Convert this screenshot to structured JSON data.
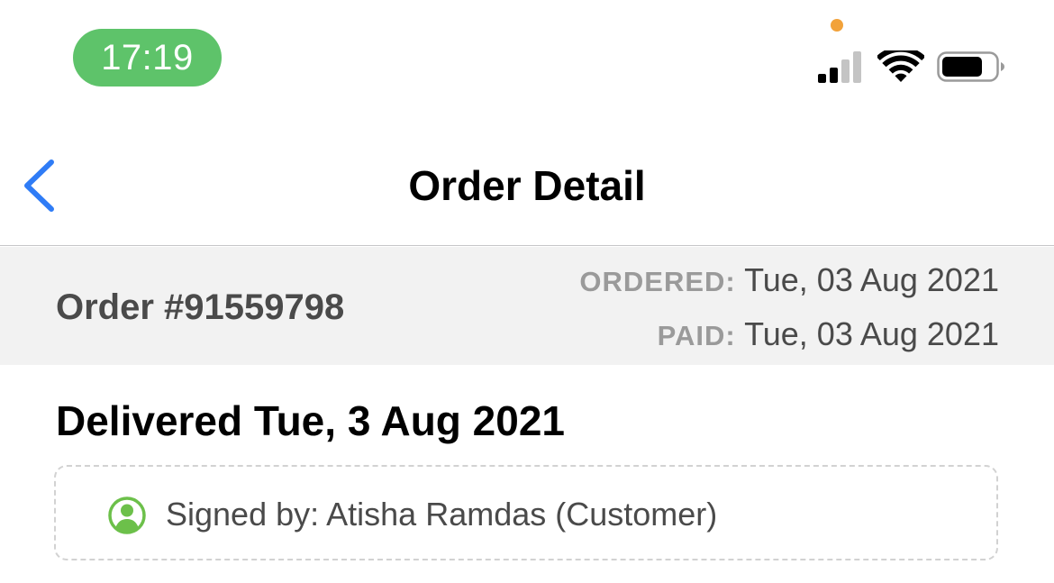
{
  "status_bar": {
    "time": "17:19",
    "icons": [
      "signal-icon",
      "wifi-icon",
      "battery-icon"
    ],
    "colors": {
      "time_pill": "#5ec36a",
      "privacy_dot": "#f2a23a"
    }
  },
  "nav": {
    "title": "Order Detail",
    "back_icon": "chevron-left-icon",
    "accent_color": "#2f7cf6"
  },
  "order": {
    "number": "Order #91559798",
    "ordered_label": "ORDERED:",
    "ordered_date": "Tue, 03 Aug 2021",
    "paid_label": "PAID:",
    "paid_date": "Tue, 03 Aug 2021"
  },
  "delivery": {
    "heading": "Delivered Tue, 3 Aug 2021",
    "signed_by": "Signed by: Atisha Ramdas (Customer)",
    "signed_icon": "user-circle-icon",
    "signed_icon_color": "#6cc04a"
  }
}
